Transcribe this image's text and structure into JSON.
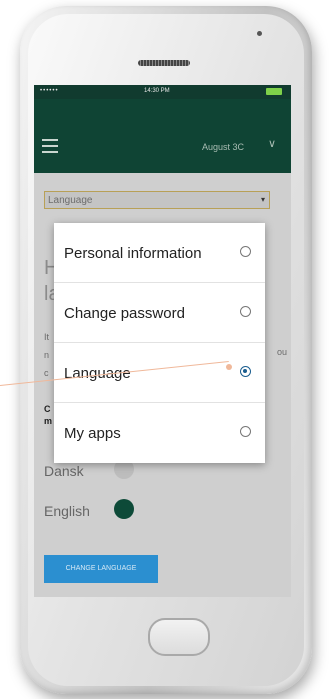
{
  "status_bar": {
    "signal": "••••••",
    "time": "14:30 PM"
  },
  "app_bar": {
    "date": "August 3C"
  },
  "dropdown": {
    "label": "Language"
  },
  "background": {
    "heading_line1": "H",
    "heading_line2": "la",
    "side_text": "ou",
    "text_lines": [
      "It",
      "n",
      "c"
    ],
    "bold_lines": [
      "C",
      "m"
    ],
    "options": [
      {
        "label": "Dansk",
        "selected": false
      },
      {
        "label": "English",
        "selected": true
      }
    ],
    "button_label": "CHANGE LANGUAGE"
  },
  "menu": {
    "items": [
      {
        "label": "Personal information",
        "selected": false
      },
      {
        "label": "Change password",
        "selected": false
      },
      {
        "label": "Language",
        "selected": true
      },
      {
        "label": "My apps",
        "selected": false
      }
    ]
  },
  "colors": {
    "app_bar": "#0f4434",
    "accent_button": "#2b8fd0",
    "radio_selected": "#1b5e8f"
  }
}
